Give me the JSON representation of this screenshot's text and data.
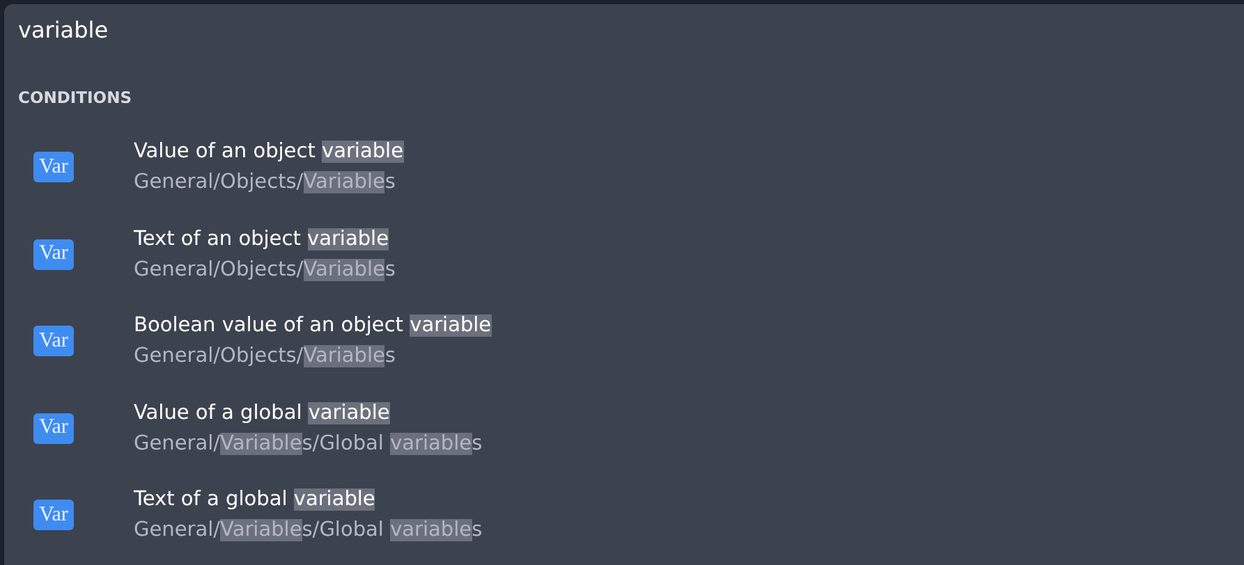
{
  "search": {
    "value": "variable"
  },
  "section": {
    "heading": "CONDITIONS"
  },
  "results": [
    {
      "badge": "Var",
      "title": [
        {
          "text": "Value of an object ",
          "match": false
        },
        {
          "text": "variable",
          "match": true
        }
      ],
      "path": [
        {
          "text": "General/Objects/",
          "match": false
        },
        {
          "text": "Variable",
          "match": true
        },
        {
          "text": "s",
          "match": false
        }
      ]
    },
    {
      "badge": "Var",
      "title": [
        {
          "text": "Text of an object ",
          "match": false
        },
        {
          "text": "variable",
          "match": true
        }
      ],
      "path": [
        {
          "text": "General/Objects/",
          "match": false
        },
        {
          "text": "Variable",
          "match": true
        },
        {
          "text": "s",
          "match": false
        }
      ]
    },
    {
      "badge": "Var",
      "title": [
        {
          "text": "Boolean value of an object ",
          "match": false
        },
        {
          "text": "variable",
          "match": true
        }
      ],
      "path": [
        {
          "text": "General/Objects/",
          "match": false
        },
        {
          "text": "Variable",
          "match": true
        },
        {
          "text": "s",
          "match": false
        }
      ]
    },
    {
      "badge": "Var",
      "title": [
        {
          "text": "Value of a global ",
          "match": false
        },
        {
          "text": "variable",
          "match": true
        }
      ],
      "path": [
        {
          "text": "General/",
          "match": false
        },
        {
          "text": "Variable",
          "match": true
        },
        {
          "text": "s/Global ",
          "match": false
        },
        {
          "text": "variable",
          "match": true
        },
        {
          "text": "s",
          "match": false
        }
      ]
    },
    {
      "badge": "Var",
      "title": [
        {
          "text": "Text of a global ",
          "match": false
        },
        {
          "text": "variable",
          "match": true
        }
      ],
      "path": [
        {
          "text": "General/",
          "match": false
        },
        {
          "text": "Variable",
          "match": true
        },
        {
          "text": "s/Global ",
          "match": false
        },
        {
          "text": "variable",
          "match": true
        },
        {
          "text": "s",
          "match": false
        }
      ]
    }
  ]
}
